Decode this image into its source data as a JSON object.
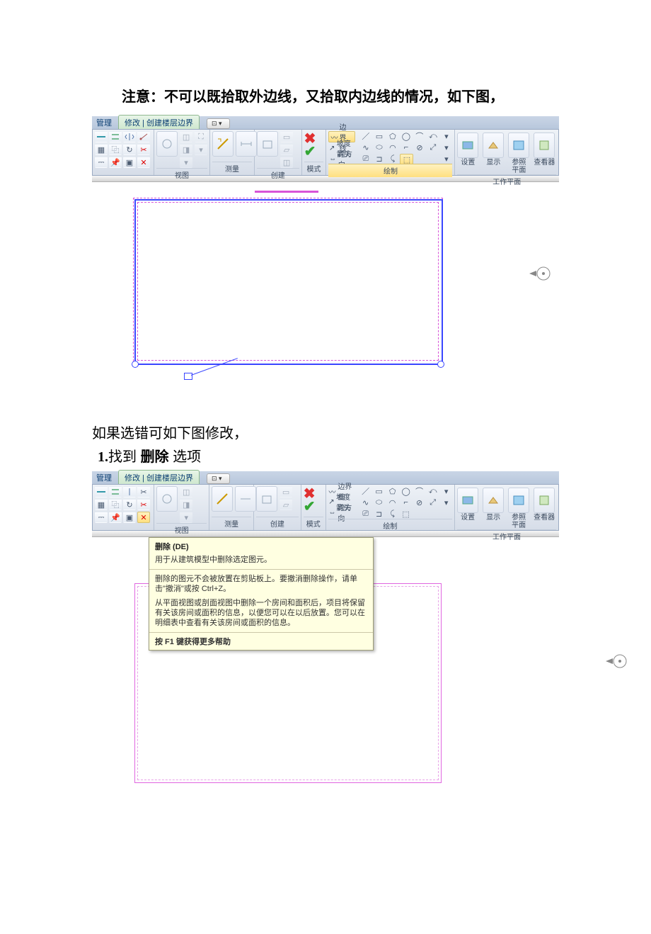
{
  "doc": {
    "note_line": "注意：不可以既拾取外边线，又拾取内边线的情况，如下图，",
    "fix_intro": "如果选错可如下图修改，",
    "step1_num": "1.",
    "step1_a": "找到 ",
    "step1_b": "删除",
    "step1_c": " 选项"
  },
  "ribbon": {
    "tab_manage": "管理",
    "tab_modify_ctx": "修改 | 创建楼层边界",
    "panel_view": "视图",
    "panel_measure": "测量",
    "panel_create": "创建",
    "panel_mode": "模式",
    "panel_draw": "绘制",
    "panel_workplane": "工作平面",
    "btn_boundary": "边界线",
    "btn_slope": "坡度箭头",
    "btn_span": "跨方向",
    "wp_set": "设置",
    "wp_show": "显示",
    "wp_ref": "参照\n平面",
    "wp_viewer": "查看器",
    "dropdown": "⊡ ▾"
  },
  "tooltip": {
    "title": "删除 (DE)",
    "sub": "用于从建筑模型中删除选定图元。",
    "p1": "删除的图元不会被放置在剪贴板上。要撤消删除操作，请单击\"撤消\"或按 Ctrl+Z。",
    "p2": "从平面视图或剖面视图中删除一个房间和面积后，项目将保留有关该房间或面积的信息，以便您可以在以后放置。您可以在明细表中查看有关该房间或面积的信息。",
    "f1": "按 F1 键获得更多帮助"
  }
}
